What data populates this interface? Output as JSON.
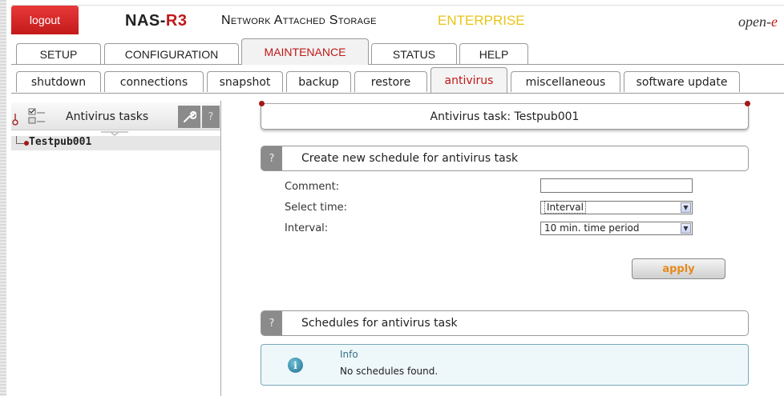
{
  "header": {
    "logout_label": "logout",
    "brand_prefix": "NAS-",
    "brand_suffix": "R3",
    "product_name": "Network Attached Storage",
    "edition": "ENTERPRISE",
    "logo_main": "open-",
    "logo_e": "e"
  },
  "main_tabs": [
    "SETUP",
    "CONFIGURATION",
    "MAINTENANCE",
    "STATUS",
    "HELP"
  ],
  "main_tab_active": "MAINTENANCE",
  "sub_tabs": [
    "shutdown",
    "connections",
    "snapshot",
    "backup",
    "restore",
    "antivirus",
    "miscellaneous",
    "software update"
  ],
  "sub_tab_active": "antivirus",
  "left_panel": {
    "title": "Antivirus tasks",
    "help_symbol": "?",
    "tree_items": [
      "Testpub001"
    ]
  },
  "content": {
    "page_title": "Antivirus task: Testpub001",
    "create_section": {
      "help_symbol": "?",
      "title": "Create new schedule for antivirus task",
      "comment_label": "Comment:",
      "comment_value": "",
      "select_time_label": "Select time:",
      "select_time_value": "Interval",
      "interval_label": "Interval:",
      "interval_value": "10 min. time period",
      "apply_label": "apply"
    },
    "schedules_section": {
      "help_symbol": "?",
      "title": "Schedules for antivirus task",
      "info_title": "Info",
      "info_message": "No schedules found."
    }
  },
  "colors": {
    "accent_red": "#c01818",
    "edition_yellow": "#e8c518",
    "apply_orange": "#e58a1c"
  }
}
